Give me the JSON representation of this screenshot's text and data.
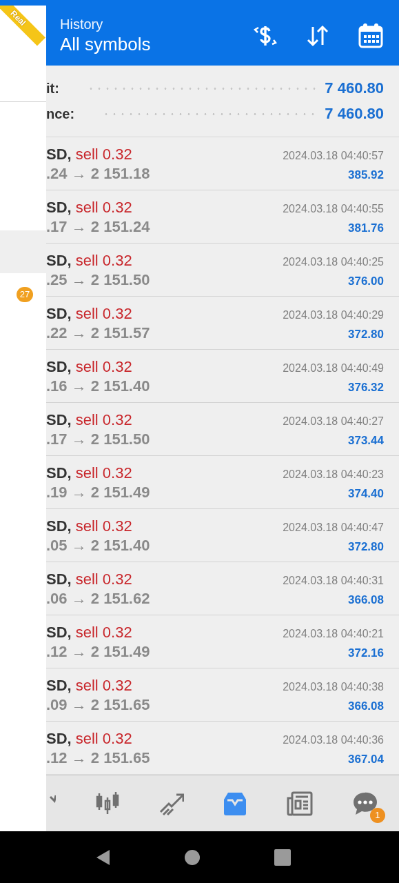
{
  "drawer": {
    "ribbon": "Real",
    "items": [
      {
        "selected": true
      },
      {
        "selected": false,
        "count": "27"
      }
    ]
  },
  "header": {
    "subtitle": "History",
    "title": "All symbols"
  },
  "summary": [
    {
      "label": "it:",
      "value": "7 460.80"
    },
    {
      "label": "nce:",
      "value": "7 460.80"
    }
  ],
  "trades": [
    {
      "symbol": "SD,",
      "order": "sell 0.32",
      "prices": ".24 → 2 151.18",
      "time": "2024.03.18 04:40:57",
      "profit": "385.92"
    },
    {
      "symbol": "SD,",
      "order": "sell 0.32",
      "prices": ".17 → 2 151.24",
      "time": "2024.03.18 04:40:55",
      "profit": "381.76"
    },
    {
      "symbol": "SD,",
      "order": "sell 0.32",
      "prices": ".25 → 2 151.50",
      "time": "2024.03.18 04:40:25",
      "profit": "376.00"
    },
    {
      "symbol": "SD,",
      "order": "sell 0.32",
      "prices": ".22 → 2 151.57",
      "time": "2024.03.18 04:40:29",
      "profit": "372.80"
    },
    {
      "symbol": "SD,",
      "order": "sell 0.32",
      "prices": ".16 → 2 151.40",
      "time": "2024.03.18 04:40:49",
      "profit": "376.32"
    },
    {
      "symbol": "SD,",
      "order": "sell 0.32",
      "prices": ".17 → 2 151.50",
      "time": "2024.03.18 04:40:27",
      "profit": "373.44"
    },
    {
      "symbol": "SD,",
      "order": "sell 0.32",
      "prices": ".19 → 2 151.49",
      "time": "2024.03.18 04:40:23",
      "profit": "374.40"
    },
    {
      "symbol": "SD,",
      "order": "sell 0.32",
      "prices": ".05 → 2 151.40",
      "time": "2024.03.18 04:40:47",
      "profit": "372.80"
    },
    {
      "symbol": "SD,",
      "order": "sell 0.32",
      "prices": ".06 → 2 151.62",
      "time": "2024.03.18 04:40:31",
      "profit": "366.08"
    },
    {
      "symbol": "SD,",
      "order": "sell 0.32",
      "prices": ".12 → 2 151.49",
      "time": "2024.03.18 04:40:21",
      "profit": "372.16"
    },
    {
      "symbol": "SD,",
      "order": "sell 0.32",
      "prices": ".09 → 2 151.65",
      "time": "2024.03.18 04:40:38",
      "profit": "366.08"
    },
    {
      "symbol": "SD,",
      "order": "sell 0.32",
      "prices": ".12 → 2 151.65",
      "time": "2024.03.18 04:40:36",
      "profit": "367.04"
    }
  ],
  "nav": [
    {
      "kind": "quotes",
      "selected": false
    },
    {
      "kind": "chart",
      "selected": false
    },
    {
      "kind": "trade",
      "selected": false
    },
    {
      "kind": "history",
      "selected": true
    },
    {
      "kind": "news",
      "selected": false
    },
    {
      "kind": "chat",
      "selected": false,
      "badge": "1"
    }
  ]
}
